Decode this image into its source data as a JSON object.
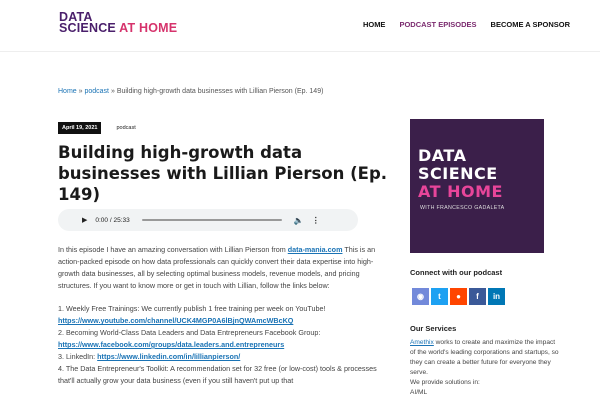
{
  "header": {
    "logo_line1": "DATA",
    "logo_line2a": "SCIENCE",
    "logo_line2b": " AT HOME",
    "nav": [
      {
        "label": "HOME"
      },
      {
        "label": "PODCAST EPISODES"
      },
      {
        "label": "BECOME A SPONSOR"
      }
    ]
  },
  "breadcrumb": {
    "home": "Home",
    "sep1": " » ",
    "podcast": "podcast",
    "sep2": " » ",
    "current": "Building high-growth data businesses with Lillian Pierson (Ep. 149)"
  },
  "meta": {
    "date": "April 19, 2021",
    "category": "podcast"
  },
  "post": {
    "title": "Building high-growth data businesses with Lillian Pierson (Ep. 149)",
    "player": {
      "time": "0:00 / 25:33",
      "progress": 0.0
    },
    "intro_a": "In this episode I have an amazing conversation with Lillian Pierson from ",
    "intro_link": "data-mania.com",
    "intro_b": " This is an action-packed episode on how data professionals can quickly convert their data expertise into high-growth data businesses, all by selecting optimal business models, revenue models, and pricing structures. If you want to know more or get in touch with Lillian, follow the links below:",
    "item1_text": "1. Weekly Free Trainings: We currently publish 1 free training per week on YouTube!",
    "item1_link": "https://www.youtube.com/channel/UCK4MGP0A6lBjnQWAmcWBcKQ",
    "item2_text": "2. Becoming World-Class Data Leaders and Data Entrepreneurs Facebook Group:",
    "item2_link": "https://www.facebook.com/groups/data.leaders.and.entrepreneurs",
    "item3_text": "3. LinkedIn: ",
    "item3_link": "https://www.linkedin.com/in/lillianpierson/",
    "item4_text": "4. The Data Entrepreneur's Toolkit: A recommendation set for 32 free (or low-cost) tools & processes that'll actually grow your data business (even if you still haven't put up that"
  },
  "sidebar": {
    "image": {
      "line1": "DATA",
      "line2": "SCIENCE",
      "line3": "AT HOME",
      "line4": "WITH FRANCESCO GADALETA"
    },
    "connect_heading": "Connect with our podcast",
    "socials": [
      {
        "icon": "discord-icon",
        "glyph": "◉",
        "color": "#7289da"
      },
      {
        "icon": "twitter-icon",
        "glyph": "t",
        "color": "#1da1f2"
      },
      {
        "icon": "reddit-icon",
        "glyph": "●",
        "color": "#ff4500"
      },
      {
        "icon": "facebook-icon",
        "glyph": "f",
        "color": "#3b5998"
      },
      {
        "icon": "linkedin-icon",
        "glyph": "in",
        "color": "#0077b5"
      }
    ],
    "services_heading": "Our Services",
    "services_link": "Amethix",
    "services_text": " works to create and maximize the impact of the world's leading corporations and startups, so they can create a better future for everyone they serve.",
    "services_sub": "We provide solutions in: ",
    "services_item": "AI/ML"
  }
}
